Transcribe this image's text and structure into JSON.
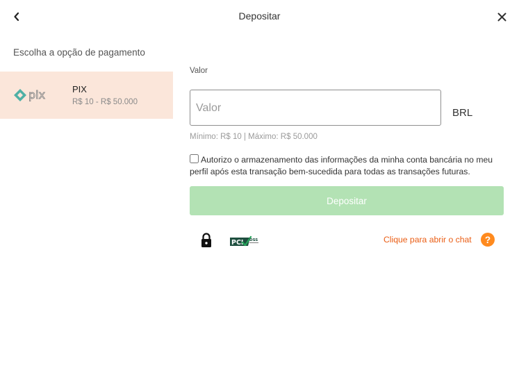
{
  "header": {
    "title": "Depositar",
    "back_icon": "chevron-left-icon",
    "close_icon": "close-icon"
  },
  "payment_section": {
    "label": "Escolha a opção de pagamento",
    "methods": [
      {
        "name": "PIX",
        "range": "R$ 10 - R$ 50.000",
        "logo": "pix-logo",
        "selected": true
      }
    ]
  },
  "form": {
    "amount_label": "Valor",
    "amount_value": "",
    "amount_placeholder": "Valor",
    "currency": "BRL",
    "limits": "Mínimo: R$ 10 | Máximo: R$ 50.000",
    "consent_checked": false,
    "consent_text": "Autorizo o armazenamento das informações da minha conta bancária no meu perfil após esta transação bem-sucedida para todas as transações futuras.",
    "submit_label": "Depositar"
  },
  "footer": {
    "lock_icon": "lock-icon",
    "badge": "pci-dss-logo",
    "chat_link": "Clique para abrir o chat",
    "help_icon": "help-icon",
    "help_glyph": "?"
  },
  "colors": {
    "selected_bg": "#fbe6da",
    "button_disabled": "#b3e2b4",
    "link": "#ea5d14",
    "help": "#ff8a1e"
  }
}
